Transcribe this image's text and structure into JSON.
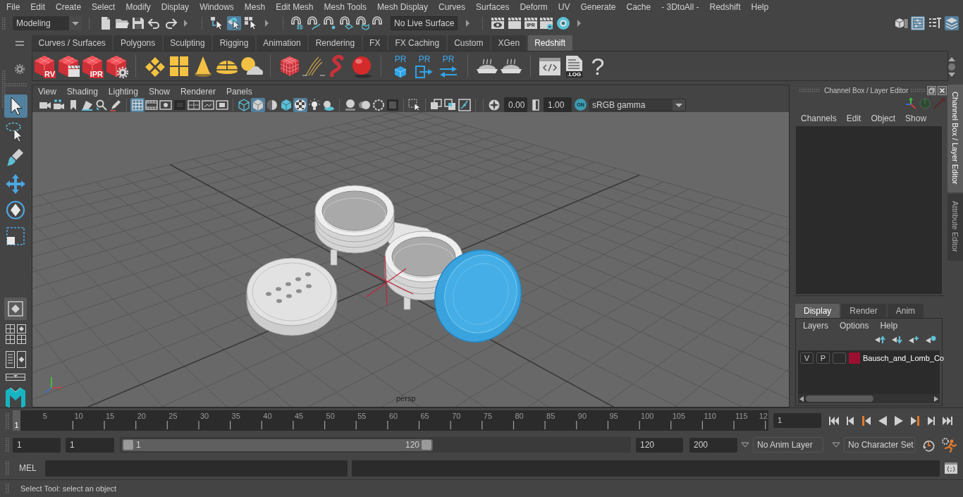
{
  "menu_bar": [
    "File",
    "Edit",
    "Create",
    "Select",
    "Modify",
    "Display",
    "Windows",
    "Mesh",
    "Edit Mesh",
    "Mesh Tools",
    "Mesh Display",
    "Curves",
    "Surfaces",
    "Deform",
    "UV",
    "Generate",
    "Cache",
    "- 3DtoAll -",
    "Redshift",
    "Help"
  ],
  "status_line": {
    "mode": "Modeling",
    "select_modes": [
      {
        "selected": false
      },
      {
        "selected": true
      },
      {
        "selected": false
      }
    ],
    "live_surface": "No Live Surface",
    "ipr_label": "IPR",
    "panel_toggles": [
      {
        "on": false
      },
      {
        "on": true
      },
      {
        "on": false
      },
      {
        "on": true
      }
    ]
  },
  "shelf": {
    "tabs": [
      {
        "label": "Curves / Surfaces",
        "selected": false
      },
      {
        "label": "Polygons",
        "selected": false
      },
      {
        "label": "Sculpting",
        "selected": false
      },
      {
        "label": "Rigging",
        "selected": false
      },
      {
        "label": "Animation",
        "selected": false
      },
      {
        "label": "Rendering",
        "selected": false
      },
      {
        "label": "FX",
        "selected": false
      },
      {
        "label": "FX Caching",
        "selected": false
      },
      {
        "label": "Custom",
        "selected": false
      },
      {
        "label": "XGen",
        "selected": false
      },
      {
        "label": "Redshift",
        "selected": true
      }
    ],
    "buttons": [
      {
        "kind": "cube",
        "label": "RV"
      },
      {
        "kind": "cube-clapper"
      },
      {
        "kind": "cube",
        "label": "IPR"
      },
      {
        "kind": "cube-gear"
      },
      {
        "kind": "separator"
      },
      {
        "kind": "diamond"
      },
      {
        "kind": "tiles"
      },
      {
        "kind": "cone"
      },
      {
        "kind": "dome"
      },
      {
        "kind": "sun"
      },
      {
        "kind": "separator"
      },
      {
        "kind": "rubik"
      },
      {
        "kind": "hair"
      },
      {
        "kind": "worm"
      },
      {
        "kind": "sphere"
      },
      {
        "kind": "separator"
      },
      {
        "kind": "pr-box",
        "label": "PR"
      },
      {
        "kind": "pr-export",
        "label": "PR"
      },
      {
        "kind": "pr-swap",
        "label": "PR"
      },
      {
        "kind": "separator"
      },
      {
        "kind": "pie"
      },
      {
        "kind": "pie"
      },
      {
        "kind": "separator"
      },
      {
        "kind": "code"
      },
      {
        "kind": "log",
        "label": ".LOG"
      },
      {
        "kind": "help",
        "label": "?"
      }
    ]
  },
  "toolbox": {
    "tools": [
      {
        "selected": true
      },
      {
        "selected": false
      },
      {
        "selected": false
      },
      {
        "selected": false
      },
      {
        "selected": false
      },
      {
        "selected": false
      }
    ]
  },
  "viewport": {
    "menu": [
      "View",
      "Shading",
      "Lighting",
      "Show",
      "Renderer",
      "Panels"
    ],
    "toolbar": [
      {
        "on": false
      },
      {
        "on": false
      },
      {
        "on": false
      },
      {
        "on": false
      },
      {
        "on": false
      },
      {
        "on": false
      },
      {
        "on": true
      },
      {
        "on": false
      },
      {
        "on": false
      },
      {
        "on": false
      },
      {
        "on": false
      },
      {
        "on": false
      },
      {
        "on": false
      },
      {
        "on": false
      },
      {
        "on": true
      },
      {
        "on": false
      },
      {
        "on": false
      },
      {
        "on": true
      },
      {
        "on": false
      },
      {
        "on": false
      },
      {
        "on": false
      },
      {
        "on": false
      },
      {
        "on": false
      },
      {
        "on": false
      },
      {
        "on": false
      },
      {
        "on": false
      },
      {
        "on": false
      },
      {
        "on": false
      },
      {
        "on": false
      },
      {
        "on": false
      }
    ],
    "exposure": "0.00",
    "gamma": "1.00",
    "view_transform": {
      "label": "ON",
      "on": true
    },
    "color_space": "sRGB gamma",
    "camera": "persp"
  },
  "channel_box": {
    "title": "Channel Box / Layer Editor",
    "menu": [
      "Channels",
      "Edit",
      "Object",
      "Show"
    ]
  },
  "layer_editor": {
    "tabs": [
      {
        "label": "Display",
        "selected": true
      },
      {
        "label": "Render",
        "selected": false
      },
      {
        "label": "Anim",
        "selected": false
      }
    ],
    "menu": [
      "Layers",
      "Options",
      "Help"
    ],
    "layers": [
      {
        "visibility": "V",
        "playback": "P",
        "color": "#9b1030",
        "name": "Bausch_and_Lomb_Co"
      }
    ]
  },
  "side_tabs": [
    {
      "label": "Channel Box / Layer Editor",
      "selected": true
    },
    {
      "label": "Attribute Editor",
      "selected": false
    }
  ],
  "time_slider": {
    "ticks": [
      "5",
      "10",
      "15",
      "20",
      "25",
      "30",
      "35",
      "40",
      "45",
      "50",
      "55",
      "60",
      "65",
      "70",
      "75",
      "80",
      "85",
      "90",
      "95",
      "100",
      "105",
      "110",
      "115",
      "12"
    ],
    "current_frame": "1",
    "level": 0,
    "frame_field": "1"
  },
  "range": {
    "start": "1",
    "playback_start": "1",
    "range_start": "1",
    "range_end": "120",
    "playback_end": "120",
    "end": "200",
    "anim_layer": "No Anim Layer",
    "character_set": "No Character Set"
  },
  "command_line": {
    "language": "MEL"
  },
  "help_line": "Select Tool: select an object"
}
